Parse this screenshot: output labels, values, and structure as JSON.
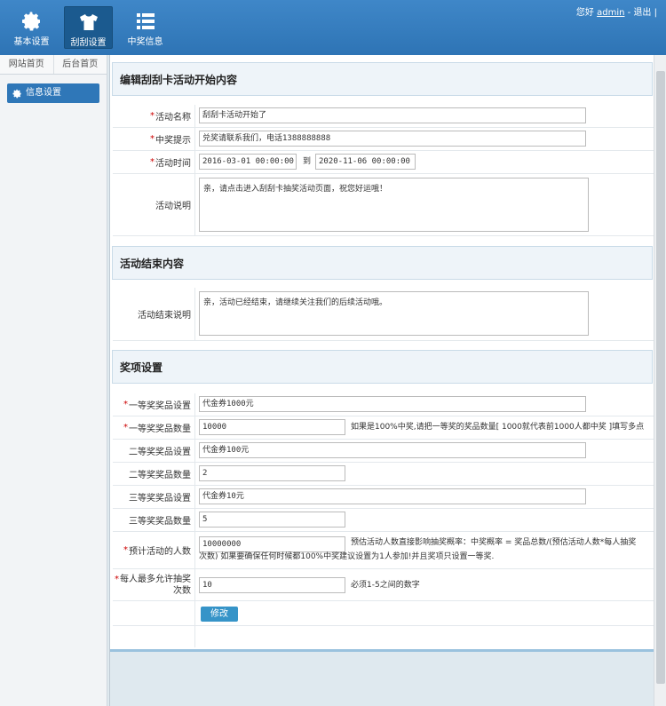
{
  "nav": {
    "items": [
      {
        "label": "基本设置",
        "icon": "gear-icon"
      },
      {
        "label": "刮刮设置",
        "icon": "shirt-icon"
      },
      {
        "label": "中奖信息",
        "icon": "list-icon"
      }
    ]
  },
  "user": {
    "greeting": "您好",
    "name": "admin",
    "sep": "-",
    "logout": "退出",
    "bar": "|"
  },
  "sidebar": {
    "tabs": [
      "网站首页",
      "后台首页"
    ],
    "items": [
      {
        "label": "信息设置",
        "icon": "gear-icon"
      }
    ]
  },
  "sections": {
    "start": "编辑刮刮卡活动开始内容",
    "end": "活动结束内容",
    "prize": "奖项设置"
  },
  "form": {
    "activity_name": {
      "label": "活动名称",
      "value": "刮刮卡活动开始了"
    },
    "win_tip": {
      "label": "中奖提示",
      "value": "兑奖请联系我们，电话1388888888"
    },
    "activity_time": {
      "label": "活动时间",
      "start": "2016-03-01 00:00:00",
      "to": "到",
      "end": "2020-11-06 00:00:00"
    },
    "activity_desc": {
      "label": "活动说明",
      "value": "亲，请点击进入刮刮卡抽奖活动页面，祝您好运哦！"
    },
    "end_desc": {
      "label": "活动结束说明",
      "value": "亲，活动已经结束，请继续关注我们的后续活动哦。"
    },
    "prize1_setting": {
      "label": "一等奖奖品设置",
      "value": "代金券1000元"
    },
    "prize1_count": {
      "label": "一等奖奖品数量",
      "value": "10000",
      "hint": "如果是100%中奖,请把一等奖的奖品数量[ 1000就代表前1000人都中奖 ]填写多点"
    },
    "prize2_setting": {
      "label": "二等奖奖品设置",
      "value": "代金券100元"
    },
    "prize2_count": {
      "label": "二等奖奖品数量",
      "value": "2"
    },
    "prize3_setting": {
      "label": "三等奖奖品设置",
      "value": "代金券10元"
    },
    "prize3_count": {
      "label": "三等奖奖品数量",
      "value": "5"
    },
    "expected_people": {
      "label": "预计活动的人数",
      "value": "10000000",
      "hint_line1": "预估活动人数直接影响抽奖概率：中奖概率 = 奖品总数/(预估活动人数*每人抽奖",
      "hint_line2": "次数) 如果要确保任何时候都100%中奖建议设置为1人参加!并且奖项只设置一等奖."
    },
    "max_draws": {
      "label_line1": "每人最多允许抽奖",
      "label_line2": "次数",
      "value": "10",
      "hint": "必须1-5之间的数字"
    },
    "submit": "修改"
  }
}
